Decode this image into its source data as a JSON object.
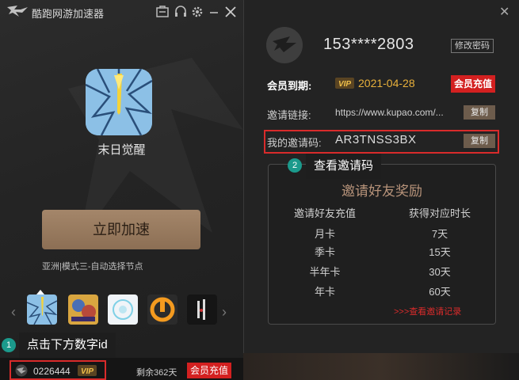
{
  "app": {
    "title": "酷跑网游加速器"
  },
  "game": {
    "name": "末日觉醒"
  },
  "accelerate_button": "立即加速",
  "node_info": "亚洲|模式三-自动选择节点",
  "tips": [
    {
      "num": "1",
      "text": "点击下方数字id"
    },
    {
      "num": "2",
      "text": "查看邀请码"
    }
  ],
  "user_bar": {
    "id": "0226444",
    "vip": "VIP",
    "remaining": "剩余362天",
    "charge": "会员充值"
  },
  "profile": {
    "phone": "153****2803",
    "change_password": "修改密码",
    "expire_label": "会员到期:",
    "vip": "VIP",
    "expire_date": "2021-04-28",
    "charge": "会员充值",
    "link_label": "邀请链接:",
    "link_value": "https://www.kupao.com/...",
    "copy": "复制",
    "code_label": "我的邀请码:",
    "code_value": "AR3TNSS3BX"
  },
  "rewards": {
    "title": "邀请好友奖励",
    "headers": [
      "邀请好友充值",
      "获得对应时长"
    ],
    "rows": [
      [
        "月卡",
        "7天"
      ],
      [
        "季卡",
        "15天"
      ],
      [
        "半年卡",
        "30天"
      ],
      [
        "年卡",
        "60天"
      ]
    ],
    "record_link": ">>>查看邀请记录"
  },
  "colors": {
    "accent_red": "#d32020",
    "gold": "#e8b03b",
    "teal": "#1b9a8c",
    "brown": "#a4866a"
  },
  "icons": [
    "logo-icon",
    "message-icon",
    "headset-icon",
    "gear-icon",
    "minimize-icon",
    "close-icon",
    "chevron-left-icon",
    "chevron-right-icon"
  ]
}
